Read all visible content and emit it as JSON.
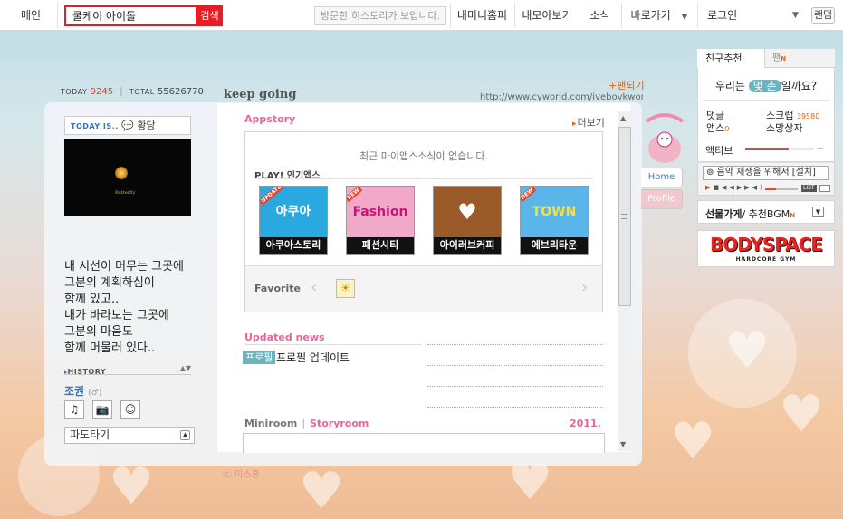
{
  "topbar": {
    "home": "메인",
    "search_value": "쿨케이 아이돌",
    "search_button": "검색",
    "history_placeholder": "방문한 히스토리가 보입니다.",
    "my_homepage": "내미니홈피",
    "my_view": "내모아보기",
    "news": "소식",
    "shortcuts": "바로가기",
    "login": "로그인",
    "random": "랜덤"
  },
  "stats": {
    "today_label": "TODAY",
    "today_value": "9245",
    "sep": "|",
    "total_label": "TOTAL",
    "total_value": "55626770"
  },
  "header": {
    "title": "keep going",
    "url": "http://www.cyworld.com/ivebovkwon",
    "fan_link": "팬되기"
  },
  "profile": {
    "today_is_label": "TODAY IS..",
    "mood": "💬 황당",
    "image_caption": "Butterfly",
    "text": "내 시선이 머무는 그곳에\n그분의 계획하심이\n함께 있고..\n내가 바라보는 그곳에\n그분의 마음도\n함께 머물러 있다..",
    "history_label": "HISTORY",
    "owner_name": "조권",
    "owner_gender": "(♂)",
    "icons": [
      "♫",
      "📷",
      "☺"
    ],
    "waves_label": "파도타기"
  },
  "appstory": {
    "title": "Appstory",
    "more": "더보기",
    "no_news": "최근 마이앱스소식이 없습니다.",
    "play_title": "PLAY! 인기앱스",
    "apps": [
      {
        "name": "아쿠아스토리",
        "tag": "UPDATE",
        "art": "아쿠아",
        "bg": "#2aa9e0"
      },
      {
        "name": "패션시티",
        "tag": "NEW",
        "art": "Fashion",
        "bg": "#f2a8c8"
      },
      {
        "name": "아이러브커피",
        "tag": "",
        "art": "♥",
        "bg": "#9a5a2a"
      },
      {
        "name": "에브리타운",
        "tag": "NEW",
        "art": "TOWN",
        "bg": "#5ab6e8"
      }
    ],
    "favorite_label": "Favorite"
  },
  "news": {
    "title": "Updated news",
    "badge": "프로필",
    "text": "프로필 업데이트"
  },
  "miniroom": {
    "label": "Miniroom",
    "sep": "|",
    "story": "Storyroom",
    "year": "2011."
  },
  "side_tabs": {
    "home": "Home",
    "profile": "Profile"
  },
  "right": {
    "tab_friend": "친구추천",
    "tab_fan": "팬",
    "friend_q_pre": "우리는",
    "friend_q_pill": "몇 촌",
    "friend_q_post": "일까요?",
    "comment_label": "댓글",
    "scrap_label": "스크랩",
    "scrap_value": "39580",
    "apps_label": "앱스",
    "apps_value": "0",
    "shop_label": "소망상자",
    "active_label": "액티브",
    "bgm_title": "음악 재생을 위해서 [설치]",
    "bgm_list": "LIST",
    "shop_store": "선물가게",
    "shop_bgm": "/ 추천BGM",
    "banner_main": "BODYSPACE",
    "banner_sub": "HARDCORE GYM"
  },
  "watermark": "ⓒ 미스홍",
  "colors": {
    "accent_red": "#e51e25",
    "pink_title": "#e6679a",
    "orange": "#e5630f",
    "teal_badge": "#6ab3bf",
    "link_blue": "#3a73b5"
  }
}
